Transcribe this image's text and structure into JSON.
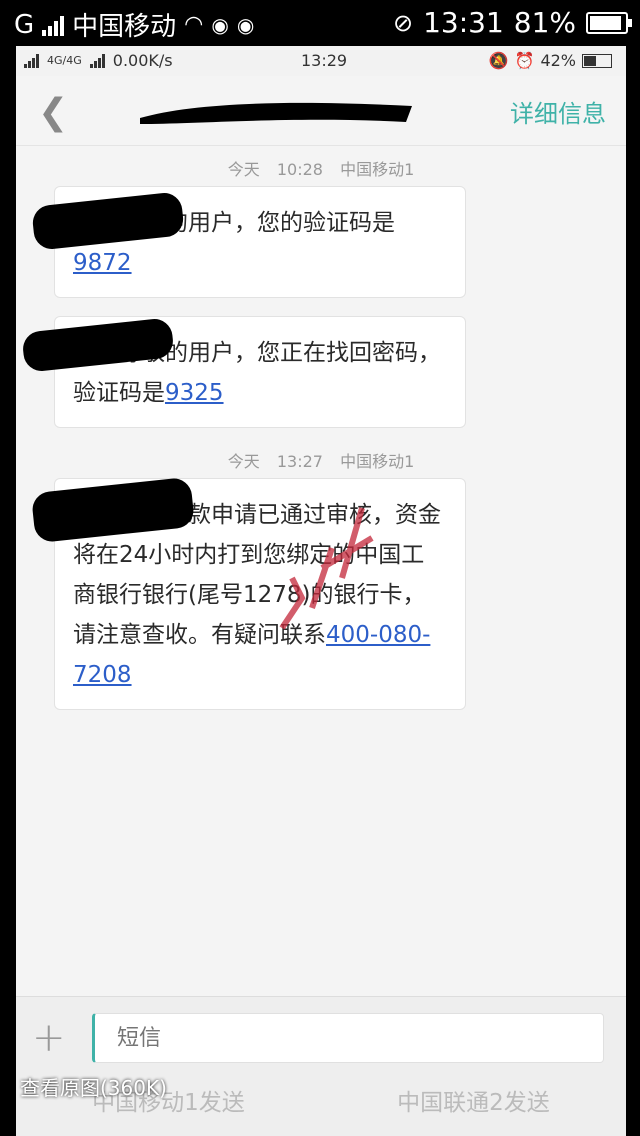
{
  "outer_status": {
    "network": "G",
    "carrier": "中国移动",
    "time": "13:31",
    "battery_pct": "81%",
    "battery_level": 0.81,
    "icons": [
      "signal-icon",
      "wifi-icon",
      "weibo-icon",
      "weibo-icon",
      "mute-icon",
      "battery-icon"
    ]
  },
  "inner_status": {
    "network_label": "4G/4G",
    "speed": "0.00K/s",
    "time": "13:29",
    "battery_pct": "42%",
    "battery_level": 0.42,
    "icons": [
      "alarm-bell-icon",
      "clock-icon",
      "battery-icon"
    ]
  },
  "nav": {
    "back_icon": "chevron-left-icon",
    "detail_label": "详细信息"
  },
  "messages": [
    {
      "time_today": "今天",
      "time": "10:28",
      "sim": "中国移动1",
      "text_before": "【】尊敬的用户，您的验证码是",
      "link": "9872"
    },
    {
      "text_before": "【】尊敬的用户，您正在找回密码，验证码是",
      "link": "9325"
    },
    {
      "time_today": "今天",
      "time": "13:27",
      "sim": "中国移动1",
      "text_before": "【】您的借款申请已通过审核，资金将在24小时内打到您绑定的中国工商银行银行(尾号1278)的银行卡，请注意查收。有疑问联系",
      "link": "400-080-7208"
    }
  ],
  "composer": {
    "plus_icon": "plus-icon",
    "placeholder": "短信",
    "send_sim1": "中国移动1发送",
    "send_sim2": "中国联通2发送"
  },
  "overlay": {
    "view_original": "查看原图(360K)"
  }
}
